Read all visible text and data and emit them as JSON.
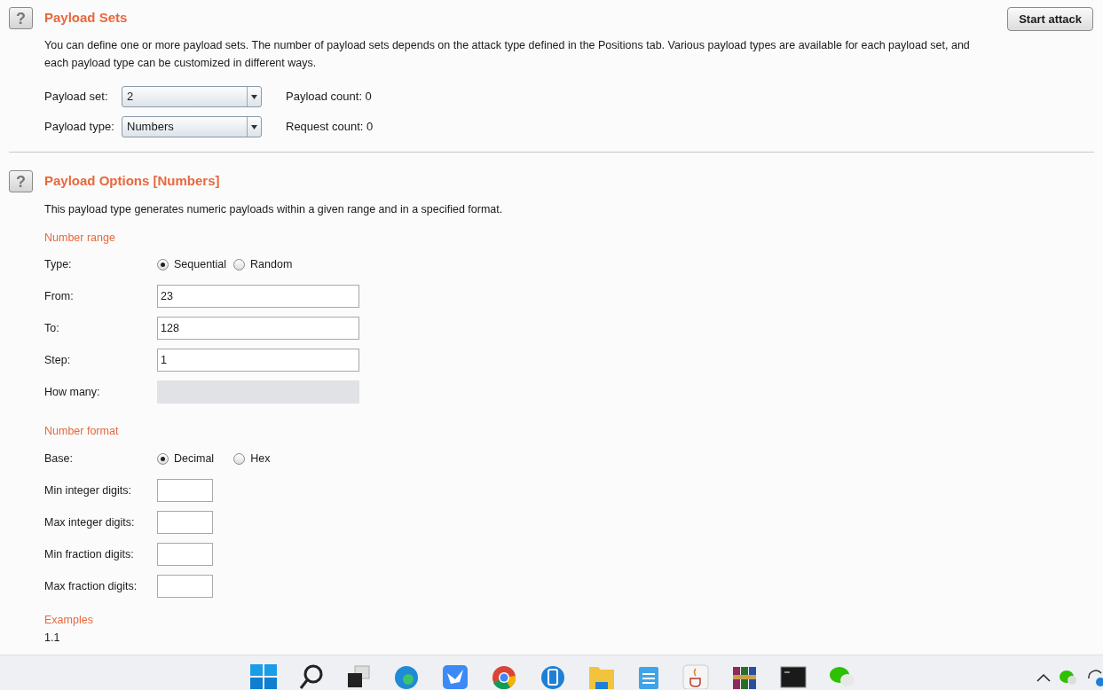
{
  "payload_sets": {
    "title": "Payload Sets",
    "help_button": "?",
    "start_button": "Start attack",
    "description": "You can define one or more payload sets. The number of payload sets depends on the attack type defined in the Positions tab. Various payload types are available for each payload set, and each payload type can be customized in different ways.",
    "fields": [
      {
        "label": "Payload set:",
        "value": "2",
        "info": "Payload count: 0"
      },
      {
        "label": "Payload type:",
        "value": "Numbers",
        "info": "Request count: 0"
      }
    ]
  },
  "payload_options": {
    "title": "Payload Options [Numbers]",
    "help_button": "?",
    "description": "This payload type generates numeric payloads within a given range and in a specified format.",
    "groups": [
      {
        "heading": "Number range",
        "rows": [
          {
            "kind": "radio",
            "label": "Type:",
            "options": [
              {
                "label": "Sequential",
                "selected": true
              },
              {
                "label": "Random",
                "selected": false
              }
            ]
          },
          {
            "kind": "field",
            "label": "From:",
            "value": "23",
            "disabled": false
          },
          {
            "kind": "field",
            "label": "To:",
            "value": "128",
            "disabled": false
          },
          {
            "kind": "field",
            "label": "Step:",
            "value": "1",
            "disabled": false
          },
          {
            "kind": "field",
            "label": "How many:",
            "disabled": true
          }
        ]
      },
      {
        "heading": "Number format",
        "rows": [
          {
            "kind": "radio",
            "label": "Base:",
            "options": [
              {
                "label": "Decimal",
                "selected": true
              },
              {
                "label": "Hex",
                "selected": false
              }
            ]
          },
          {
            "kind": "small_field",
            "label": "Min integer digits:"
          },
          {
            "kind": "small_field",
            "label": "Max integer digits:"
          },
          {
            "kind": "small_field",
            "label": "Min fraction digits:"
          },
          {
            "kind": "small_field",
            "label": "Max fraction digits:"
          }
        ]
      },
      {
        "heading": "Examples",
        "lines": [
          "1.1"
        ]
      }
    ]
  }
}
